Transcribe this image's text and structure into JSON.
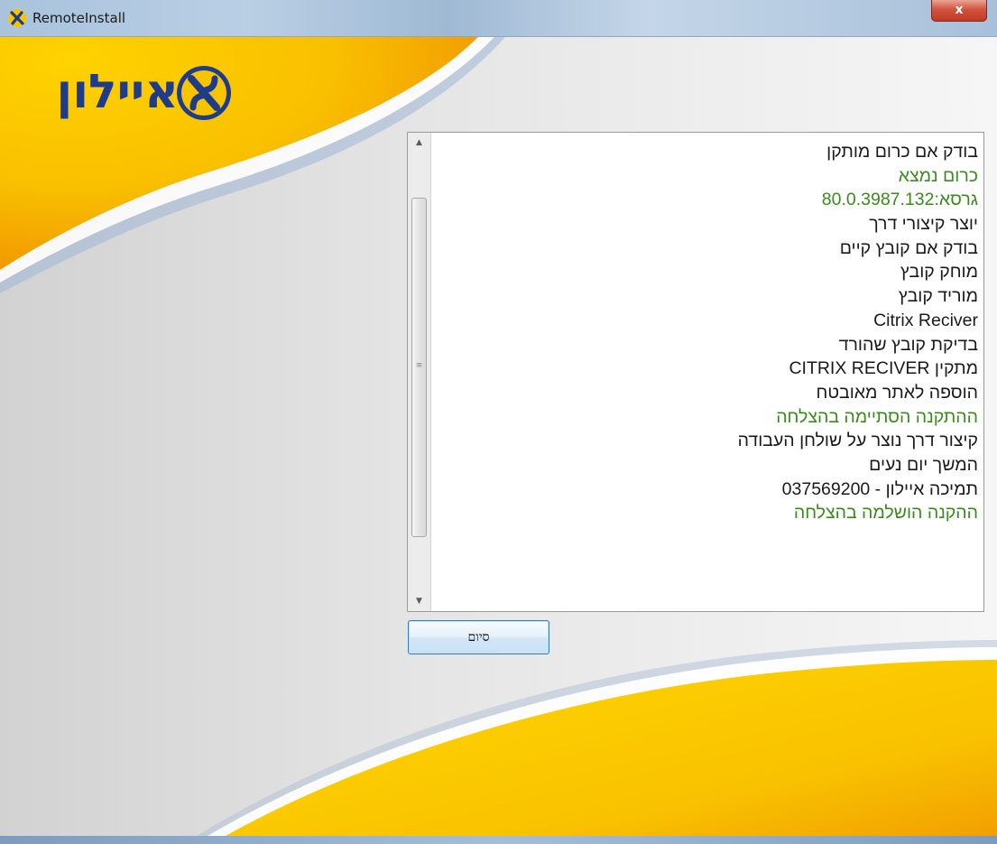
{
  "window": {
    "title": "RemoteInstall",
    "close_label": "x",
    "icon": "app-logo-icon"
  },
  "logo": {
    "text": "איילון",
    "badge_letter": "א",
    "badge_icon": "ayalon-badge-icon"
  },
  "log": {
    "lines": [
      {
        "text": "בודק אם כרום מותקן",
        "color": "#1a1a1a"
      },
      {
        "text": "כרום נמצא",
        "color": "#3a8a1e"
      },
      {
        "text": "גרסא:80.0.3987.132",
        "color": "#3a8a1e"
      },
      {
        "text": "יוצר קיצורי דרך",
        "color": "#1a1a1a"
      },
      {
        "text": "בודק אם קובץ קיים",
        "color": "#1a1a1a"
      },
      {
        "text": "מוחק קובץ",
        "color": "#1a1a1a"
      },
      {
        "text": "מוריד קובץ",
        "color": "#1a1a1a"
      },
      {
        "text": "Citrix Reciver",
        "color": "#1a1a1a"
      },
      {
        "text": "בדיקת קובץ שהורד",
        "color": "#1a1a1a"
      },
      {
        "text": "מתקין CITRIX RECIVER",
        "color": "#1a1a1a"
      },
      {
        "text": "הוספה לאתר מאובטח",
        "color": "#1a1a1a"
      },
      {
        "text": "ההתקנה הסתיימה בהצלחה",
        "color": "#3a8a1e"
      },
      {
        "text": "קיצור דרך נוצר על שולחן העבודה",
        "color": "#1a1a1a"
      },
      {
        "text": "המשך יום נעים",
        "color": "#1a1a1a"
      },
      {
        "text": "תמיכה איילון - 037569200",
        "color": "#1a1a1a"
      },
      {
        "text": "ההקנה הושלמה בהצלחה",
        "color": "#3a8a1e"
      }
    ]
  },
  "buttons": {
    "finish_label": "סיום"
  },
  "colors": {
    "logo_blue": "#1f3b8c",
    "accent_yellow": "#f7c500",
    "accent_orange": "#f29a00",
    "success_green": "#3a8a1e"
  }
}
